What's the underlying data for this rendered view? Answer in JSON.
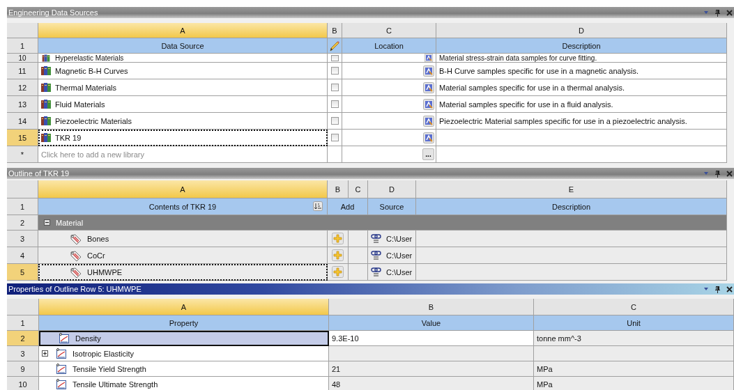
{
  "sources_panel": {
    "title": "Engineering Data Sources",
    "active": false,
    "columns": [
      "A",
      "B",
      "C",
      "D"
    ],
    "header_row": "1",
    "headers": [
      "Data Source",
      "Location",
      "Description"
    ],
    "rows": [
      {
        "row": "10",
        "kind": "partial",
        "name": "Hyperelastic Materials",
        "checked": false,
        "description": "Material stress-strain data samples for curve fitting.",
        "selected": false
      },
      {
        "row": "11",
        "kind": "full",
        "name": "Magnetic B-H Curves",
        "checked": false,
        "description": "B-H Curve samples specific for use in a magnetic analysis.",
        "selected": false
      },
      {
        "row": "12",
        "kind": "full",
        "name": "Thermal Materials",
        "checked": false,
        "description": "Material samples specific for use in a thermal analysis.",
        "selected": false
      },
      {
        "row": "13",
        "kind": "full",
        "name": "Fluid Materials",
        "checked": false,
        "description": "Material samples specific for use in a fluid analysis.",
        "selected": false
      },
      {
        "row": "14",
        "kind": "full",
        "name": "Piezoelectric Materials",
        "checked": false,
        "description": "Piezoelectric Material samples specific for use in a piezoelectric analysis.",
        "selected": false
      },
      {
        "row": "15",
        "kind": "full",
        "name": "TKR 19",
        "checked": false,
        "selected": true
      }
    ],
    "new_row": {
      "marker": "*",
      "placeholder": "Click here to add a new library",
      "browse_label": "..."
    }
  },
  "outline_panel": {
    "title": "Outline of TKR 19",
    "active": false,
    "columns": [
      "A",
      "B",
      "C",
      "D",
      "E"
    ],
    "header_row": "1",
    "headers": [
      "Contents of TKR 19",
      "Add",
      "Source",
      "Description"
    ],
    "group": {
      "row": "2",
      "label": "Material",
      "expanded": true,
      "children": [
        {
          "row": "3",
          "name": "Bones",
          "source": "C:\\User",
          "selected": false
        },
        {
          "row": "4",
          "name": "CoCr",
          "source": "C:\\User",
          "selected": false
        },
        {
          "row": "5",
          "name": "UHMWPE",
          "source": "C:\\User",
          "selected": true
        }
      ]
    }
  },
  "properties_panel": {
    "title": "Properties of Outline Row 5: UHMWPE",
    "active": true,
    "columns": [
      "A",
      "B",
      "C"
    ],
    "header_row": "1",
    "headers": [
      "Property",
      "Value",
      "Unit"
    ],
    "rows": [
      {
        "row": "2",
        "property": "Density",
        "value": "9.3E-10",
        "unit": "tonne mm^-3",
        "selected": true
      },
      {
        "row": "3",
        "property": "Isotropic Elasticity",
        "expanded": false,
        "selected": false
      },
      {
        "row": "9",
        "property": "Tensile Yield Strength",
        "value": "21",
        "unit": "MPa",
        "selected": false
      },
      {
        "row": "10",
        "property": "Tensile Ultimate Strength",
        "value": "48",
        "unit": "MPa",
        "selected": false
      }
    ]
  }
}
